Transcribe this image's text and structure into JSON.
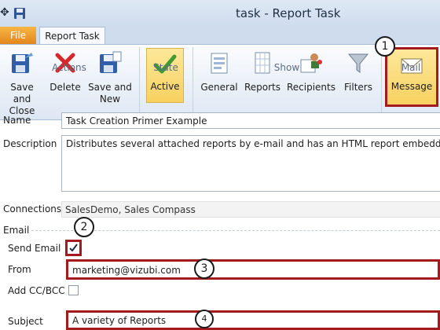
{
  "window": {
    "title": "task - Report Task"
  },
  "tabs": {
    "file": "File",
    "report_task": "Report Task"
  },
  "ribbon": {
    "save_and_close": "Save and\nClose",
    "delete": "Delete",
    "save_and_new": "Save and\nNew",
    "actions_group": "Actions",
    "active": "Active",
    "state_group": "State",
    "general": "General",
    "reports": "Reports",
    "recipients": "Recipients",
    "filters": "Filters",
    "show_group": "Show",
    "message": "Message",
    "mail_group": "Mail"
  },
  "callouts": {
    "c1": "1",
    "c2": "2",
    "c3": "3",
    "c4": "4"
  },
  "form": {
    "name_label": "Name",
    "name_value": "Task Creation Primer Example",
    "description_label": "Description",
    "description_value": "Distributes several attached reports by e-mail and has an HTML report embedded in the me",
    "connections_label": "Connections",
    "connections_value": "SalesDemo, Sales Compass",
    "email_section": "Email",
    "send_email_label": "Send Email",
    "send_email_checked": true,
    "from_label": "From",
    "from_value": "marketing@vizubi.com",
    "add_cc_bcc_label": "Add CC/BCC",
    "add_cc_bcc_checked": false,
    "subject_label": "Subject",
    "subject_value": "A variety of Reports"
  },
  "colors": {
    "highlight": "#a31a1f",
    "file_tab": "#e88f22",
    "active_fill": "#f7d160"
  }
}
